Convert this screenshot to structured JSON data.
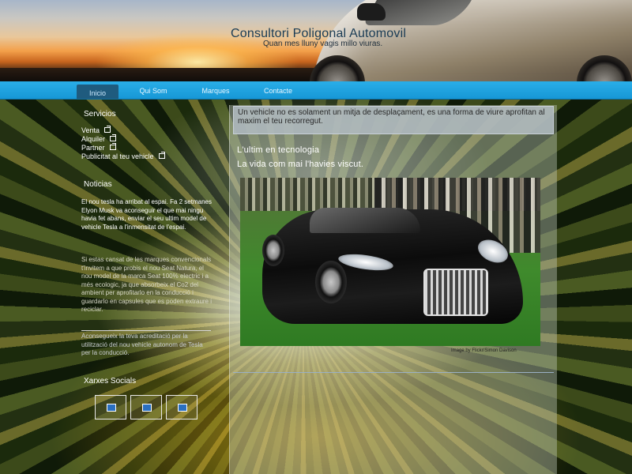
{
  "header": {
    "title": "Consultori Poligonal Automovil",
    "slogan": "Quan mes lluny vagis millo viuras."
  },
  "nav": {
    "items": [
      {
        "label": "Inicio",
        "active": true
      },
      {
        "label": "Qui Som",
        "active": false
      },
      {
        "label": "Marques",
        "active": false
      },
      {
        "label": "Contacte",
        "active": false
      }
    ]
  },
  "sidebar": {
    "servicios_heading": "Servicios",
    "servicios": [
      {
        "label": "Venta",
        "icon": "external-link-icon"
      },
      {
        "label": "Alquiler",
        "icon": "external-link-icon"
      },
      {
        "label": "Partner",
        "icon": "external-link-icon"
      },
      {
        "label": "Publicitat al teu vehicle",
        "icon": "external-link-icon"
      }
    ],
    "noticias_heading": "Noticias",
    "news": [
      "El nou tesla ha arribat al espai. Fa 2 setmanes Elyon Musk va aconseguir el que mai ningu havia fet abans, enviar el seu ultim model de vehicle Tesla a l'inmensitat de l'espai.",
      "Si estas cansat de les marques convencionals t'invitem a que probis el nou Seat Natura, el nou model de la marca Seat 100% electric i a més ecologic, ja que absorbeix el Co2 del ambient per aprofitarlo en la conducció i guardarlo en capsules que es poden extraure i reciclar.",
      "Aconsegueix la teva acreditació per la utilització del nou vehicle autonom de Tesla per la conducció."
    ],
    "socials_heading": "Xarxes Socials",
    "socials": [
      {
        "icon": "social-icon-1"
      },
      {
        "icon": "social-icon-2"
      },
      {
        "icon": "social-icon-3"
      }
    ]
  },
  "main": {
    "intro": "Un vehicle no es solament un mitja de desplaçament, es una forma de viure aprofitan al maxim el teu recorregut.",
    "heading1": "L'ultim en tecnologia",
    "heading2": "La vida com mai l'havies viscut.",
    "photo_alt": "black luxury car",
    "photo_credit": "Image by Flickr/Simon Davison"
  },
  "colors": {
    "nav_bar": "#1797d6",
    "nav_active": "#1f5b7e",
    "title_color": "#1a3c55"
  }
}
